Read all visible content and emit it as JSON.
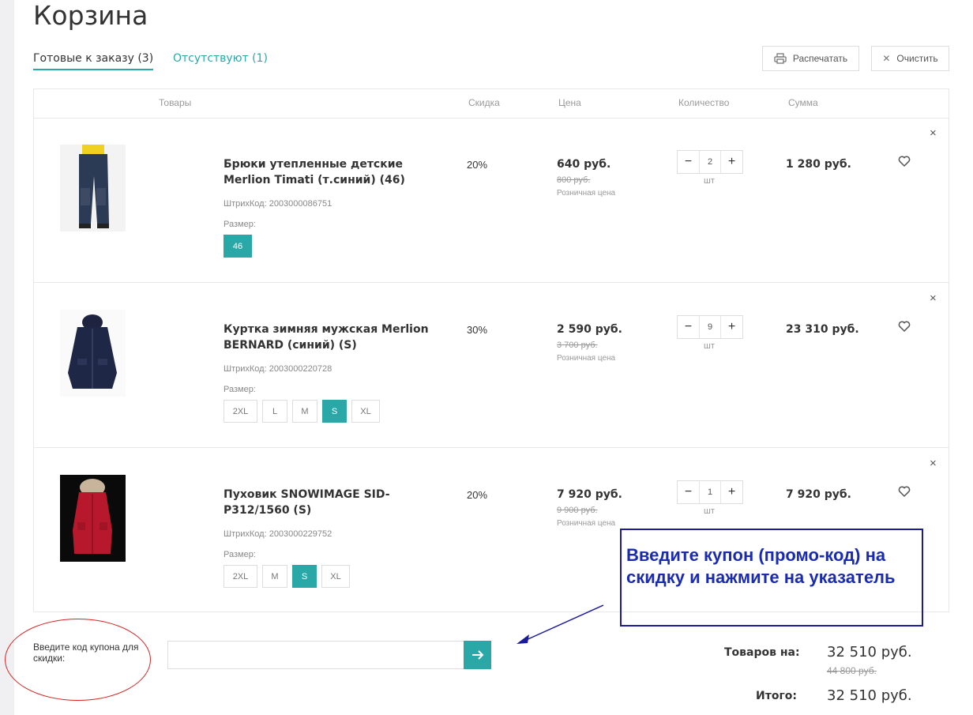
{
  "page": {
    "title": "Корзина"
  },
  "tabs": {
    "ready": "Готовые к заказу (3)",
    "missing": "Отсутствуют (1)"
  },
  "actions": {
    "print": "Распечатать",
    "clear": "Очистить"
  },
  "columns": {
    "goods": "Товары",
    "discount": "Скидка",
    "price": "Цена",
    "quantity": "Количество",
    "sum": "Сумма"
  },
  "items": [
    {
      "name": "Брюки утепленные детские Merlion Timati (т.синий) (46)",
      "barcode": "ШтрихКод: 2003000086751",
      "size_label": "Размер:",
      "sizes": [
        "46"
      ],
      "selected_size": "46",
      "discount": "20%",
      "price": "640 руб.",
      "old_price": "800 руб.",
      "retail_label": "Розничная цена",
      "qty": "2",
      "unit": "шт",
      "sum": "1 280 руб.",
      "image": "trousers-image"
    },
    {
      "name": "Куртка зимняя мужская Merlion BERNARD (синий) (S)",
      "barcode": "ШтрихКод: 2003000220728",
      "size_label": "Размер:",
      "sizes": [
        "2XL",
        "L",
        "M",
        "S",
        "XL"
      ],
      "selected_size": "S",
      "discount": "30%",
      "price": "2 590 руб.",
      "old_price": "3 700 руб.",
      "retail_label": "Розничная цена",
      "qty": "9",
      "unit": "шт",
      "sum": "23 310 руб.",
      "image": "jacket-image"
    },
    {
      "name": "Пуховик SNOWIMAGE SID-P312/1560 (S)",
      "barcode": "ШтрихКод: 2003000229752",
      "size_label": "Размер:",
      "sizes": [
        "2XL",
        "M",
        "S",
        "XL"
      ],
      "selected_size": "S",
      "discount": "20%",
      "price": "7 920 руб.",
      "old_price": "9 900 руб.",
      "retail_label": "Розничная цена",
      "qty": "1",
      "unit": "шт",
      "sum": "7 920 руб.",
      "image": "down-coat-image"
    }
  ],
  "controls": {
    "minus": "−",
    "plus": "+",
    "remove": "×"
  },
  "coupon": {
    "label": "Введите код купона для скидки:",
    "value": "",
    "placeholder": ""
  },
  "callout": "Введите купон (промо-код) на скидку и нажмите на указатель",
  "totals": {
    "goods_label": "Товаров на:",
    "goods_value": "32 510 руб.",
    "goods_old": "44 800 руб.",
    "total_label": "Итого:",
    "total_value": "32 510 руб."
  },
  "colors": {
    "accent": "#2aa7a7",
    "callout": "#1a2bb0",
    "annotation": "#d62020"
  }
}
